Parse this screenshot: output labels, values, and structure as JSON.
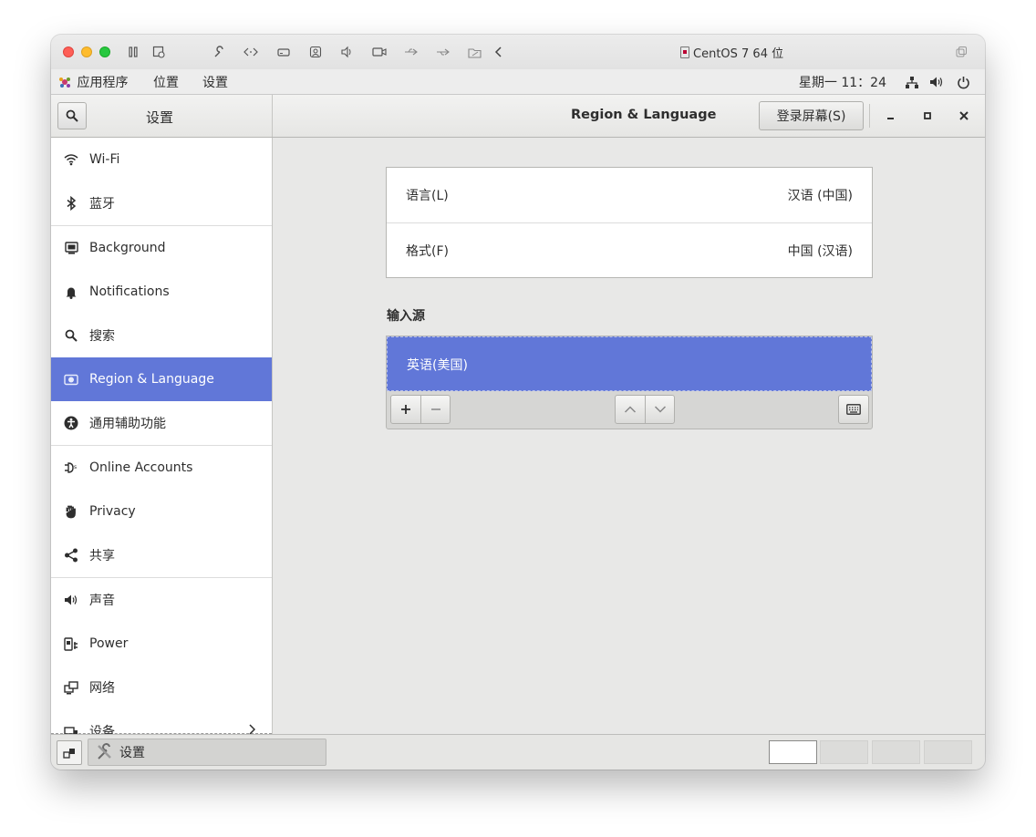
{
  "vm": {
    "title": "CentOS 7 64 位"
  },
  "topbar": {
    "menu_apps": "应用程序",
    "menu_places": "位置",
    "menu_settings": "设置",
    "clock": "星期一 11：24"
  },
  "headerbar": {
    "sidebar_title": "设置",
    "main_title": "Region & Language",
    "login_screen_label": "登录屏幕(S)"
  },
  "sidebar": {
    "items": [
      {
        "label": "Wi-Fi",
        "icon": "wifi-icon"
      },
      {
        "label": "蓝牙",
        "icon": "bluetooth-icon"
      },
      {
        "label": "Background",
        "icon": "background-icon"
      },
      {
        "label": "Notifications",
        "icon": "bell-icon"
      },
      {
        "label": "搜索",
        "icon": "search-icon"
      },
      {
        "label": "Region & Language",
        "icon": "region-icon",
        "active": true
      },
      {
        "label": "通用辅助功能",
        "icon": "accessibility-icon"
      },
      {
        "label": "Online Accounts",
        "icon": "online-accounts-icon"
      },
      {
        "label": "Privacy",
        "icon": "hand-icon"
      },
      {
        "label": "共享",
        "icon": "share-icon"
      },
      {
        "label": "声音",
        "icon": "speaker-icon"
      },
      {
        "label": "Power",
        "icon": "power-plug-icon"
      },
      {
        "label": "网络",
        "icon": "network-icon"
      },
      {
        "label": "设备",
        "icon": "devices-icon"
      }
    ]
  },
  "region": {
    "language_label": "语言(L)",
    "language_value": "汉语 (中国)",
    "formats_label": "格式(F)",
    "formats_value": "中国 (汉语)",
    "input_sources_heading": "输入源",
    "input_sources": [
      "英语(美国)"
    ]
  },
  "bottom_panel": {
    "task_label": "设置"
  },
  "colors": {
    "accent": "#6177d8",
    "background": "#e8e8e7"
  }
}
